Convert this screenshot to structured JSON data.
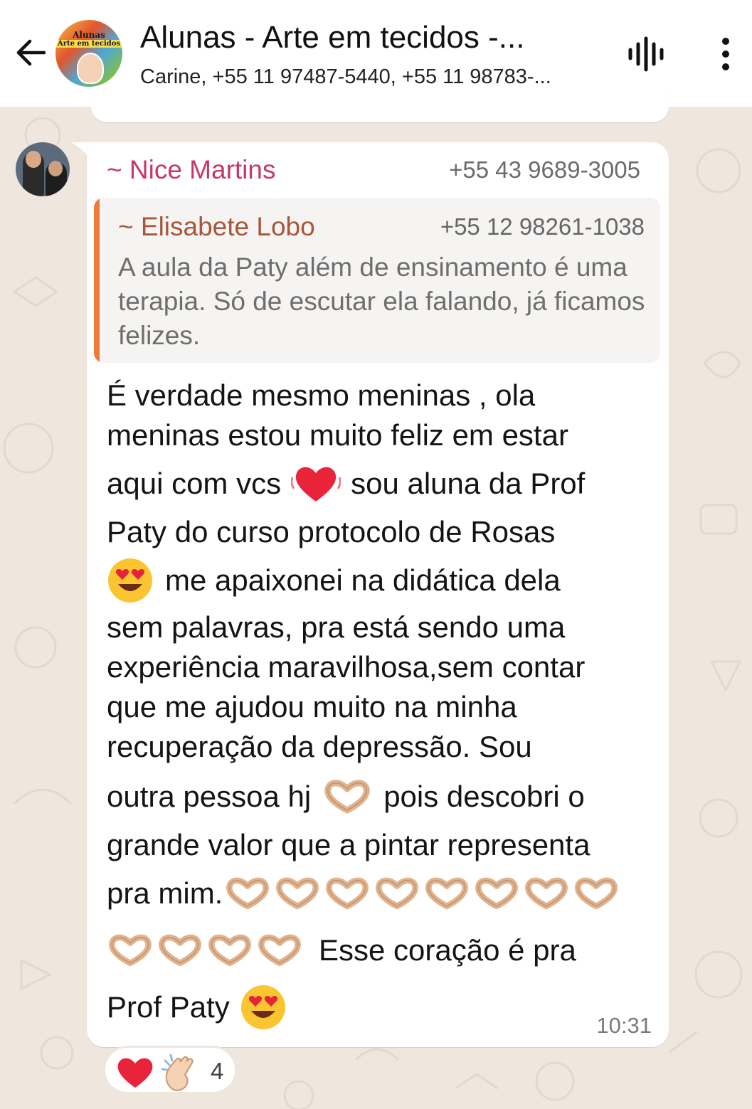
{
  "header": {
    "title": "Alunas - Arte em tecidos -...",
    "subtitle": "Carine, +55 11 97487-5440, +55 11 98783-...",
    "avatar_text_line1": "Alunas",
    "avatar_text_line2": "Arte em tecidos",
    "back_icon": "back-arrow-icon",
    "voice_icon": "voice-chat-icon",
    "menu_icon": "more-options-icon"
  },
  "message": {
    "sender_name": "~ Nice Martins",
    "sender_phone": "+55 43 9689-3005",
    "quoted": {
      "name": "~ Elisabete Lobo",
      "phone": "+55 12 98261-1038",
      "text": "A aula da Paty além de ensinamento é uma terapia. Só de escutar ela falando, já ficamos felizes."
    },
    "lines": [
      "É verdade mesmo meninas , ola",
      "meninas estou muito feliz em estar",
      "aqui com vcs",
      "sou aluna da Prof",
      "Paty do curso protocolo de Rosas",
      "me apaixonei na didática dela",
      "sem palavras, pra está sendo uma",
      "experiência maravilhosa,sem contar",
      "que me ajudou muito na minha",
      "recuperação da depressão. Sou",
      "outra pessoa hj",
      "pois descobri o",
      "grande valor que a pintar representa",
      "pra mim.",
      "Esse coração é pra",
      "Prof Paty"
    ],
    "time": "10:31"
  },
  "reactions": {
    "emojis": [
      "red-heart",
      "clapping-hands"
    ],
    "count": "4"
  },
  "colors": {
    "sender_name": "#c63868",
    "quote_accent": "#ef7a3a",
    "quote_name": "#a6563a",
    "chat_background": "#efe7de"
  }
}
